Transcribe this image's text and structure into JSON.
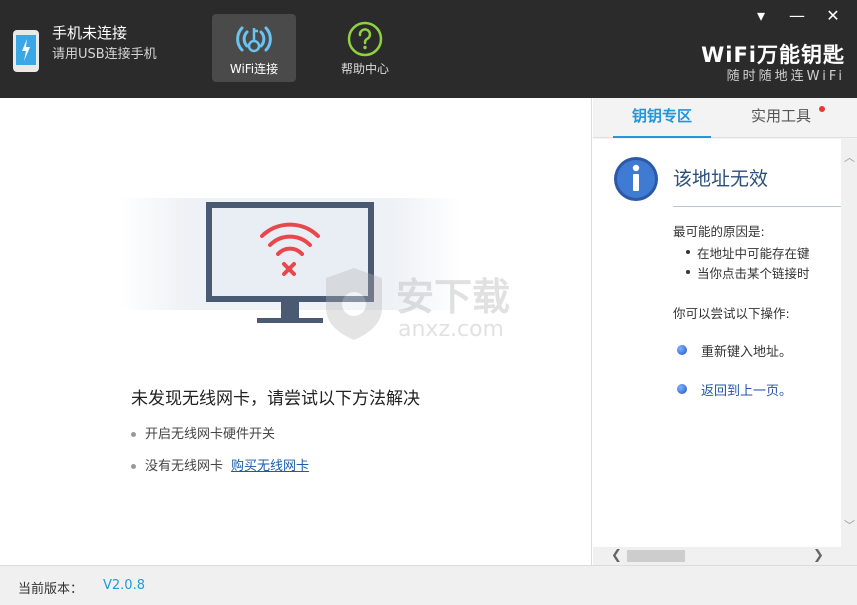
{
  "header": {
    "phone_status": "手机未连接",
    "phone_hint": "请用USB连接手机",
    "nav": {
      "wifi_label": "WiFi连接",
      "help_label": "帮助中心"
    },
    "window_controls": {
      "menu": "▾",
      "minimize": "—",
      "close": "✕"
    },
    "brand": {
      "name": "WiFi万能钥匙",
      "slogan": "随时随地连WiFi"
    }
  },
  "main": {
    "error_title": "未发现无线网卡，请尝试以下方法解决",
    "tips": [
      "开启无线网卡硬件开关",
      "没有无线网卡"
    ],
    "buy_link": "购买无线网卡",
    "watermark": {
      "text": "安下载",
      "domain": "anxz.com"
    }
  },
  "right_panel": {
    "tabs": [
      "钥钥专区",
      "实用工具"
    ],
    "page_title": "该地址无效",
    "reason_heading": "最可能的原因是:",
    "reasons": [
      "在地址中可能存在键",
      "当你点击某个链接时"
    ],
    "try_heading": "你可以尝试以下操作:",
    "actions": [
      "重新键入地址。",
      "返回到上一页。"
    ],
    "scroll_arrows": {
      "up": "︿",
      "down": "﹀",
      "left": "❮",
      "right": "❯"
    }
  },
  "status": {
    "version_label": "当前版本：",
    "version": "V2.0.8"
  },
  "colors": {
    "topbar": "#2b2b2b",
    "accent": "#2196d8",
    "wifi_error": "#e8474c",
    "monitor_frame": "#4a5a72"
  }
}
